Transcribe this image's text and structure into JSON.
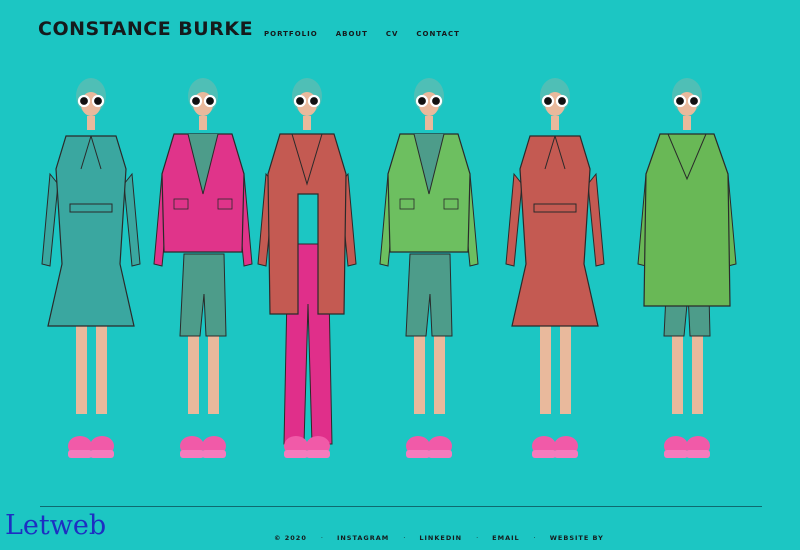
{
  "header": {
    "site_title": "CONSTANCE BURKE",
    "nav": [
      "PORTFOLIO",
      "ABOUT",
      "CV",
      "CONTACT"
    ]
  },
  "gallery": {
    "figures": [
      {
        "coat": "#3aa7a0",
        "bottom": "#3aa7a0",
        "style": "dress"
      },
      {
        "coat": "#e0348a",
        "bottom": "#4d9c8a",
        "style": "jacket-shorts"
      },
      {
        "coat": "#c45a52",
        "bottom": "#e02f8a",
        "style": "coat-pants"
      },
      {
        "coat": "#6dbf60",
        "bottom": "#4d9c8a",
        "style": "jacket-shorts"
      },
      {
        "coat": "#c45a52",
        "bottom": "#4d9c8a",
        "style": "dress"
      },
      {
        "coat": "#69b856",
        "bottom": "#4d9c8a",
        "style": "coat-shorts"
      }
    ]
  },
  "footer": {
    "copyright": "© 2020",
    "links": [
      "INSTAGRAM",
      "LINKEDIN",
      "EMAIL",
      "WEBSITE BY"
    ]
  },
  "watermark": "Letweb",
  "colors": {
    "background": "#1cc6c3",
    "hair": "#4fbfb6",
    "shoes": "#f15aa8",
    "skin": "#e9b99c"
  }
}
